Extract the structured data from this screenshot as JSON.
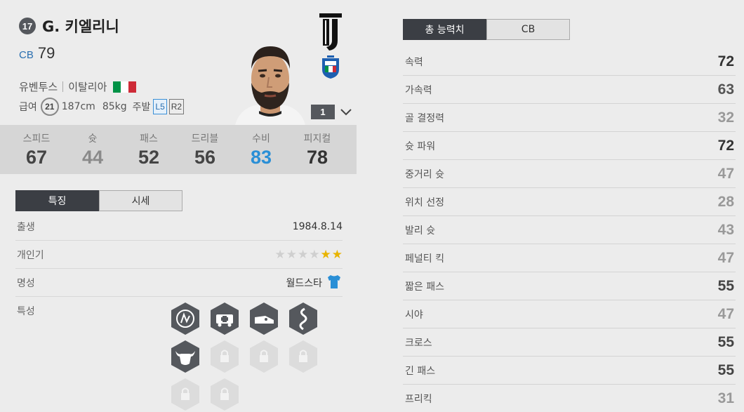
{
  "player": {
    "season_number": "17",
    "name": "G. 키엘리니",
    "position": "CB",
    "overall": "79",
    "club": "유벤투스",
    "nation": "이탈리아",
    "wage_label": "급여",
    "wage": "21",
    "height": "187cm",
    "weight": "85kg",
    "foot_label": "주발",
    "left_foot": "L5",
    "right_foot": "R2",
    "rank": "1"
  },
  "colors": {
    "flag_green": "#009246",
    "flag_white": "#ffffff",
    "flag_red": "#ce2b37",
    "highlight_blue": "#2a8fd6",
    "dark_tab": "#3b3e44"
  },
  "attributes": [
    {
      "label": "스피드",
      "value": "67",
      "color": "#444444"
    },
    {
      "label": "슛",
      "value": "44",
      "color": "#8a8a8a"
    },
    {
      "label": "패스",
      "value": "52",
      "color": "#444444"
    },
    {
      "label": "드리블",
      "value": "56",
      "color": "#444444"
    },
    {
      "label": "수비",
      "value": "83",
      "color": "#2a8fd6"
    },
    {
      "label": "피지컬",
      "value": "78",
      "color": "#333333"
    }
  ],
  "left_tabs": {
    "features": "특징",
    "market": "시세"
  },
  "details": {
    "birth_label": "출생",
    "birth_value": "1984.8.14",
    "popularity_label": "개인기",
    "popularity_stars": 2,
    "popularity_total": 6,
    "fame_label": "명성",
    "fame_value": "월드스타",
    "fame_icon": "shirt-icon",
    "traits_label": "특성"
  },
  "traits": [
    "goalkeeper-save-icon",
    "ambulance-icon",
    "boot-star-icon",
    "snake-icon",
    "buffalo-icon"
  ],
  "locked_traits": 5,
  "right_tabs": {
    "total": "총 능력치",
    "position": "CB"
  },
  "stats": [
    {
      "label": "속력",
      "value": "72",
      "color": "#333333"
    },
    {
      "label": "가속력",
      "value": "63",
      "color": "#555555"
    },
    {
      "label": "골 결정력",
      "value": "32",
      "color": "#999999"
    },
    {
      "label": "슛 파워",
      "value": "72",
      "color": "#333333"
    },
    {
      "label": "중거리 슛",
      "value": "47",
      "color": "#999999"
    },
    {
      "label": "위치 선정",
      "value": "28",
      "color": "#999999"
    },
    {
      "label": "발리 슛",
      "value": "43",
      "color": "#999999"
    },
    {
      "label": "페널티 킥",
      "value": "47",
      "color": "#999999"
    },
    {
      "label": "짧은 패스",
      "value": "55",
      "color": "#444444"
    },
    {
      "label": "시야",
      "value": "47",
      "color": "#999999"
    },
    {
      "label": "크로스",
      "value": "55",
      "color": "#444444"
    },
    {
      "label": "긴 패스",
      "value": "55",
      "color": "#444444"
    },
    {
      "label": "프리킥",
      "value": "31",
      "color": "#999999"
    }
  ]
}
